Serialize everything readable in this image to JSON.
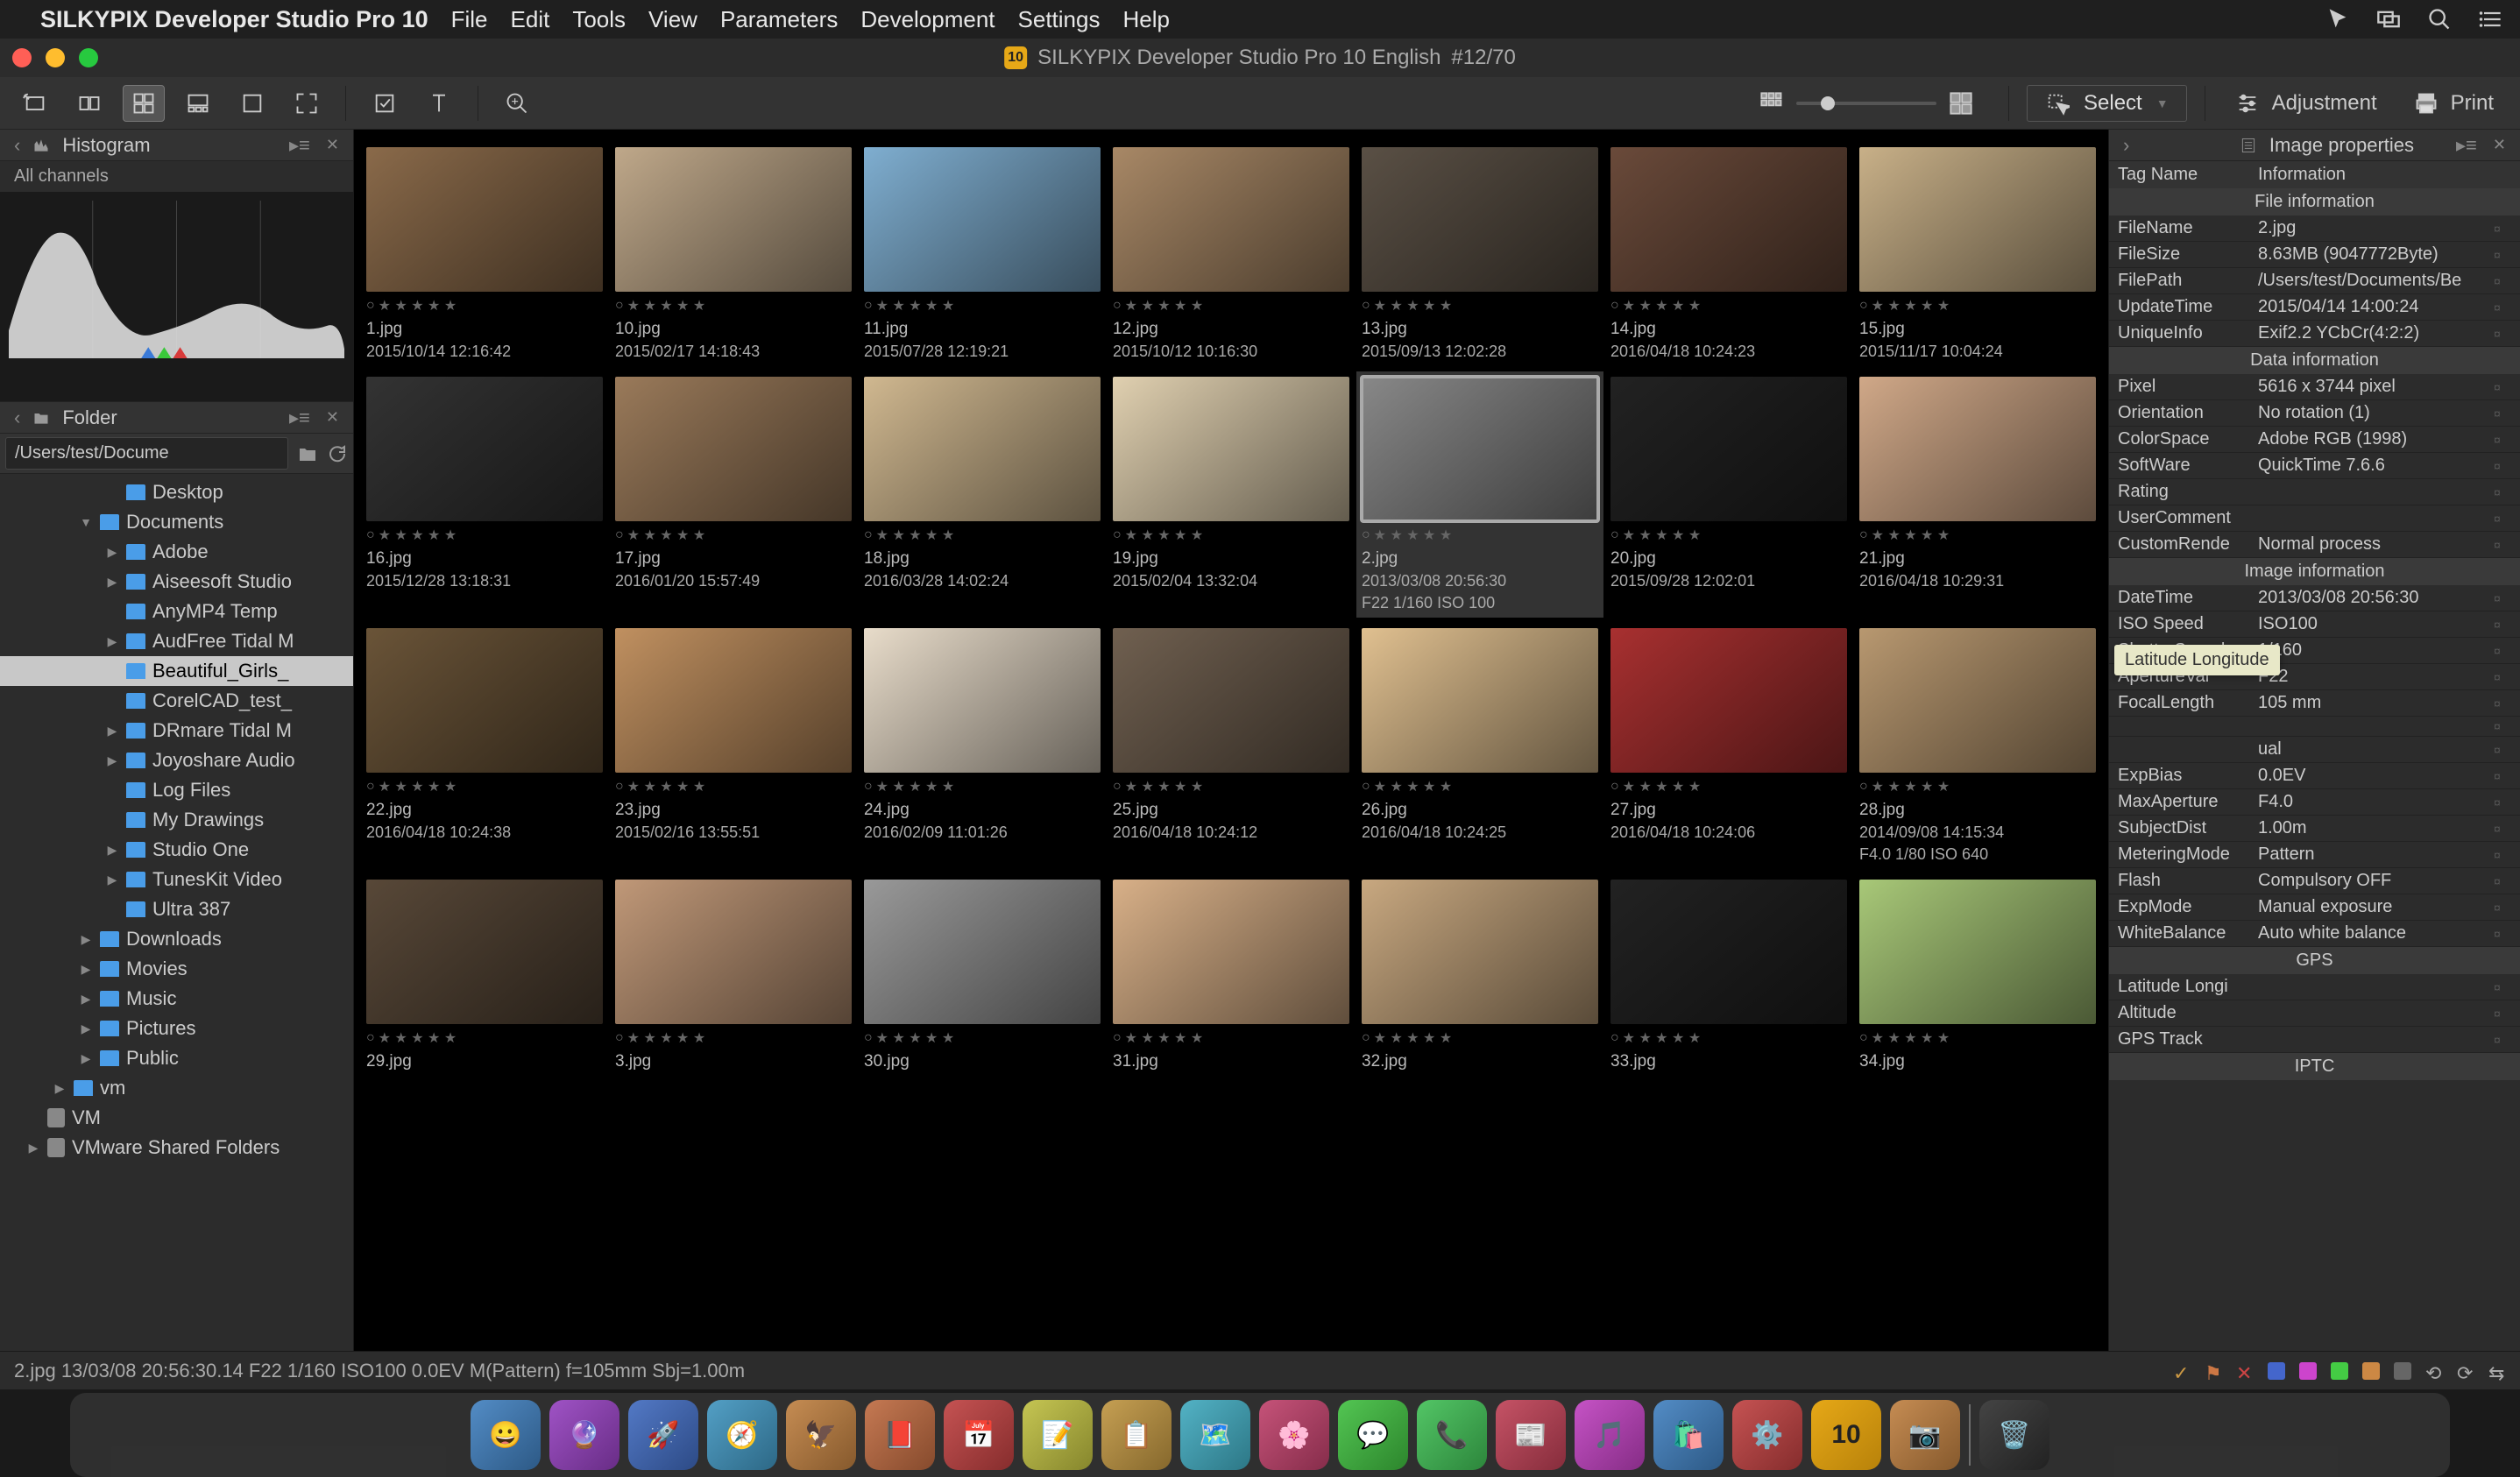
{
  "menubar": {
    "app_name": "SILKYPIX Developer Studio Pro 10",
    "items": [
      "File",
      "Edit",
      "Tools",
      "View",
      "Parameters",
      "Development",
      "Settings",
      "Help"
    ]
  },
  "window": {
    "title": "SILKYPIX Developer Studio Pro 10 English",
    "counter": "#12/70",
    "badge": "10"
  },
  "toolbar": {
    "select_label": "Select",
    "adjustment_label": "Adjustment",
    "print_label": "Print"
  },
  "histogram": {
    "title": "Histogram",
    "subtitle": "All channels"
  },
  "folder_panel": {
    "title": "Folder",
    "path": "/Users/test/Docume"
  },
  "folder_tree": [
    {
      "indent": 2,
      "name": "Desktop",
      "disc": "",
      "type": "folder"
    },
    {
      "indent": 1,
      "name": "Documents",
      "disc": "▼",
      "type": "folder"
    },
    {
      "indent": 2,
      "name": "Adobe",
      "disc": "▶",
      "type": "folder"
    },
    {
      "indent": 2,
      "name": "Aiseesoft Studio",
      "disc": "▶",
      "type": "folder"
    },
    {
      "indent": 2,
      "name": "AnyMP4 Temp",
      "disc": "",
      "type": "folder"
    },
    {
      "indent": 2,
      "name": "AudFree Tidal M",
      "disc": "▶",
      "type": "folder"
    },
    {
      "indent": 2,
      "name": "Beautiful_Girls_",
      "disc": "",
      "type": "folder",
      "selected": true
    },
    {
      "indent": 2,
      "name": "CorelCAD_test_",
      "disc": "",
      "type": "folder"
    },
    {
      "indent": 2,
      "name": "DRmare Tidal M",
      "disc": "▶",
      "type": "folder"
    },
    {
      "indent": 2,
      "name": "Joyoshare Audio",
      "disc": "▶",
      "type": "folder"
    },
    {
      "indent": 2,
      "name": "Log Files",
      "disc": "",
      "type": "folder"
    },
    {
      "indent": 2,
      "name": "My Drawings",
      "disc": "",
      "type": "folder"
    },
    {
      "indent": 2,
      "name": "Studio One",
      "disc": "▶",
      "type": "folder"
    },
    {
      "indent": 2,
      "name": "TunesKit Video",
      "disc": "▶",
      "type": "folder"
    },
    {
      "indent": 2,
      "name": "Ultra 387",
      "disc": "",
      "type": "folder"
    },
    {
      "indent": 1,
      "name": "Downloads",
      "disc": "▶",
      "type": "folder"
    },
    {
      "indent": 1,
      "name": "Movies",
      "disc": "▶",
      "type": "folder"
    },
    {
      "indent": 1,
      "name": "Music",
      "disc": "▶",
      "type": "folder"
    },
    {
      "indent": 1,
      "name": "Pictures",
      "disc": "▶",
      "type": "folder"
    },
    {
      "indent": 1,
      "name": "Public",
      "disc": "▶",
      "type": "folder"
    },
    {
      "indent": 0,
      "name": "vm",
      "disc": "▶",
      "type": "folder"
    },
    {
      "indent": -1,
      "name": "VM",
      "disc": "",
      "type": "hd"
    },
    {
      "indent": -1,
      "name": "VMware Shared Folders",
      "disc": "▶",
      "type": "hd"
    }
  ],
  "thumbs": [
    {
      "name": "1.jpg",
      "date": "2015/10/14 12:16:42",
      "bg": "#8a6a4a",
      "extra": ""
    },
    {
      "name": "10.jpg",
      "date": "2015/02/17 14:18:43",
      "bg": "#bfa88a",
      "extra": ""
    },
    {
      "name": "11.jpg",
      "date": "2015/07/28 12:19:21",
      "bg": "#7faed0",
      "extra": ""
    },
    {
      "name": "12.jpg",
      "date": "2015/10/12 10:16:30",
      "bg": "#a88866",
      "extra": ""
    },
    {
      "name": "13.jpg",
      "date": "2015/09/13 12:02:28",
      "bg": "#5a5045",
      "extra": ""
    },
    {
      "name": "14.jpg",
      "date": "2016/04/18 10:24:23",
      "bg": "#6a4a3a",
      "extra": ""
    },
    {
      "name": "15.jpg",
      "date": "2015/11/17 10:04:24",
      "bg": "#c8b088",
      "extra": ""
    },
    {
      "name": "16.jpg",
      "date": "2015/12/28 13:18:31",
      "bg": "#333",
      "extra": ""
    },
    {
      "name": "17.jpg",
      "date": "2016/01/20 15:57:49",
      "bg": "#9a7a5a",
      "extra": ""
    },
    {
      "name": "18.jpg",
      "date": "2016/03/28 14:02:24",
      "bg": "#d0b890",
      "extra": ""
    },
    {
      "name": "19.jpg",
      "date": "2015/02/04 13:32:04",
      "bg": "#e0d0b0",
      "extra": ""
    },
    {
      "name": "2.jpg",
      "date": "2013/03/08 20:56:30",
      "bg": "#888",
      "extra": "F22 1/160 ISO 100",
      "selected": true
    },
    {
      "name": "20.jpg",
      "date": "2015/09/28 12:02:01",
      "bg": "#222",
      "extra": ""
    },
    {
      "name": "21.jpg",
      "date": "2016/04/18 10:29:31",
      "bg": "#d0a888",
      "extra": ""
    },
    {
      "name": "22.jpg",
      "date": "2016/04/18 10:24:38",
      "bg": "#6a5438",
      "extra": ""
    },
    {
      "name": "23.jpg",
      "date": "2015/02/16 13:55:51",
      "bg": "#c09060",
      "extra": ""
    },
    {
      "name": "24.jpg",
      "date": "2016/02/09 11:01:26",
      "bg": "#e8dcca",
      "extra": ""
    },
    {
      "name": "25.jpg",
      "date": "2016/04/18 10:24:12",
      "bg": "#706050",
      "extra": ""
    },
    {
      "name": "26.jpg",
      "date": "2016/04/18 10:24:25",
      "bg": "#e0c090",
      "extra": ""
    },
    {
      "name": "27.jpg",
      "date": "2016/04/18 10:24:06",
      "bg": "#a83030",
      "extra": ""
    },
    {
      "name": "28.jpg",
      "date": "2014/09/08 14:15:34",
      "bg": "#b89870",
      "extra": "F4.0 1/80 ISO 640"
    },
    {
      "name": "29.jpg",
      "date": "",
      "bg": "#584838",
      "extra": ""
    },
    {
      "name": "3.jpg",
      "date": "",
      "bg": "#c09878",
      "extra": ""
    },
    {
      "name": "30.jpg",
      "date": "",
      "bg": "#999",
      "extra": ""
    },
    {
      "name": "31.jpg",
      "date": "",
      "bg": "#d8b088",
      "extra": ""
    },
    {
      "name": "32.jpg",
      "date": "",
      "bg": "#c8a880",
      "extra": ""
    },
    {
      "name": "33.jpg",
      "date": "",
      "bg": "#222",
      "extra": ""
    },
    {
      "name": "34.jpg",
      "date": "",
      "bg": "#a8c878",
      "extra": ""
    }
  ],
  "props_panel": {
    "title": "Image properties",
    "header_left": "Tag Name",
    "header_right": "Information",
    "tooltip": "Latitude Longitude",
    "sections": [
      {
        "title": "File information",
        "rows": [
          {
            "k": "FileName",
            "v": "2.jpg"
          },
          {
            "k": "FileSize",
            "v": "8.63MB (9047772Byte)"
          },
          {
            "k": "FilePath",
            "v": "/Users/test/Documents/Be"
          },
          {
            "k": "UpdateTime",
            "v": "2015/04/14 14:00:24"
          },
          {
            "k": "UniqueInfo",
            "v": "Exif2.2 YCbCr(4:2:2)"
          }
        ]
      },
      {
        "title": "Data information",
        "rows": [
          {
            "k": "Pixel",
            "v": "5616 x 3744 pixel"
          },
          {
            "k": "Orientation",
            "v": "No rotation (1)"
          },
          {
            "k": "ColorSpace",
            "v": "Adobe RGB (1998)"
          },
          {
            "k": "SoftWare",
            "v": "QuickTime 7.6.6"
          },
          {
            "k": "Rating",
            "v": ""
          },
          {
            "k": "UserComment",
            "v": ""
          },
          {
            "k": "CustomRende",
            "v": "Normal process"
          }
        ]
      },
      {
        "title": "Image information",
        "rows": [
          {
            "k": "DateTime",
            "v": "2013/03/08 20:56:30"
          },
          {
            "k": "ISO Speed",
            "v": "ISO100"
          },
          {
            "k": "ShutterSpeed",
            "v": "1/160"
          },
          {
            "k": "ApertureVal",
            "v": "F22"
          },
          {
            "k": "FocalLength",
            "v": "105 mm"
          },
          {
            "k": "",
            "v": ""
          },
          {
            "k": "",
            "v": "ual"
          },
          {
            "k": "ExpBias",
            "v": "0.0EV"
          },
          {
            "k": "MaxAperture",
            "v": "F4.0"
          },
          {
            "k": "SubjectDist",
            "v": "1.00m"
          },
          {
            "k": "MeteringMode",
            "v": "Pattern"
          },
          {
            "k": "Flash",
            "v": "Compulsory OFF"
          },
          {
            "k": "ExpMode",
            "v": "Manual exposure"
          },
          {
            "k": "WhiteBalance",
            "v": "Auto white balance"
          }
        ]
      },
      {
        "title": "GPS",
        "rows": [
          {
            "k": "Latitude Longi",
            "v": ""
          },
          {
            "k": "Altitude",
            "v": ""
          },
          {
            "k": "GPS Track",
            "v": ""
          }
        ]
      },
      {
        "title": "IPTC",
        "rows": []
      }
    ]
  },
  "statusbar": {
    "text": "2.jpg 13/03/08 20:56:30.14 F22 1/160 ISO100  0.0EV M(Pattern) f=105mm Sbj=1.00m",
    "colors": [
      "#cc9944",
      "#cc4444",
      "#cc4444",
      "#4466cc",
      "#cc44cc",
      "#44cc44",
      "#44cccc",
      "#888",
      "#888",
      "#888",
      "#888"
    ]
  },
  "dock": {
    "items": [
      "😀",
      "🔮",
      "🚀",
      "🧭",
      "🦅",
      "📕",
      "📅",
      "📝",
      "📋",
      "🗺️",
      "🌸",
      "💬",
      "📞",
      "📰",
      "🎵",
      "🛍️",
      "⚙️",
      "10",
      "📷",
      "🗑️"
    ]
  }
}
